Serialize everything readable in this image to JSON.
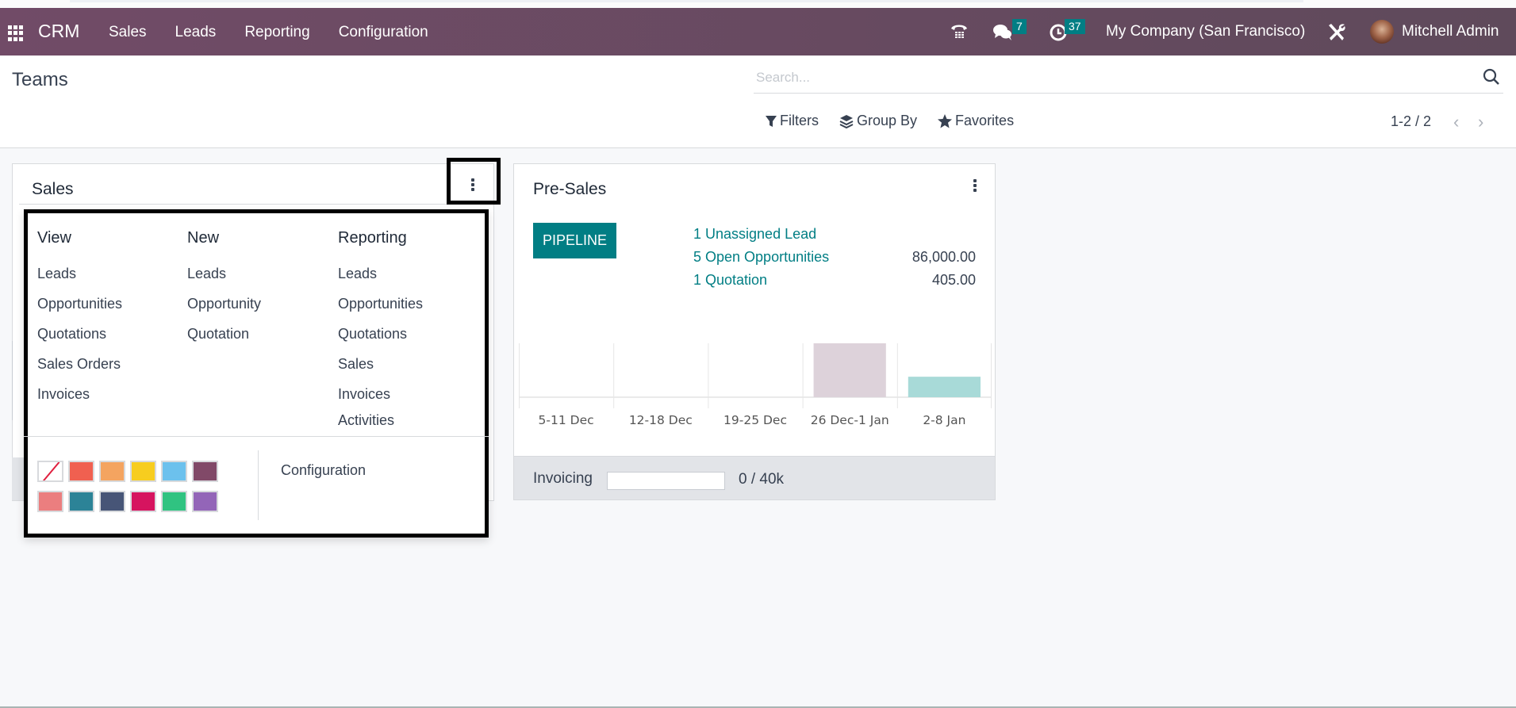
{
  "navbar": {
    "app_name": "CRM",
    "menu": [
      "Sales",
      "Leads",
      "Reporting",
      "Configuration"
    ],
    "messages_count": "7",
    "activities_count": "37",
    "company": "My Company (San Francisco)",
    "user": "Mitchell Admin",
    "icons": [
      "apps-icon",
      "phone-icon",
      "chat-icon",
      "clock-icon",
      "tools-icon"
    ]
  },
  "control_panel": {
    "title": "Teams",
    "search_placeholder": "Search...",
    "filters_label": "Filters",
    "group_by_label": "Group By",
    "favorites_label": "Favorites",
    "pager": "1-2 / 2"
  },
  "cards": {
    "sales": {
      "title": "Sales",
      "dropdown": {
        "view": {
          "heading": "View",
          "items": [
            "Leads",
            "Opportunities",
            "Quotations",
            "Sales Orders",
            "Invoices"
          ]
        },
        "new": {
          "heading": "New",
          "items": [
            "Leads",
            "Opportunity",
            "Quotation"
          ]
        },
        "reporting": {
          "heading": "Reporting",
          "items": [
            "Leads",
            "Opportunities",
            "Quotations",
            "Sales",
            "Invoices",
            "Activities"
          ]
        },
        "colors": [
          "none",
          "#f06050",
          "#f4a460",
          "#f7cd1f",
          "#6cc1ed",
          "#814968",
          "#eb7e7f",
          "#2c8397",
          "#475577",
          "#d6145f",
          "#30c381",
          "#9365b8"
        ],
        "configuration_label": "Configuration"
      }
    },
    "presales": {
      "title": "Pre-Sales",
      "pipeline_label": "PIPELINE",
      "stats": [
        {
          "label": "1 Unassigned Lead",
          "value": ""
        },
        {
          "label": "5 Open Opportunities",
          "value": "86,000.00"
        },
        {
          "label": "1 Quotation",
          "value": "405.00"
        }
      ],
      "invoicing_label": "Invoicing",
      "invoicing_progress": 0,
      "invoicing_text": "0 / 40k"
    }
  },
  "chart_data": {
    "type": "bar",
    "categories": [
      "5-11 Dec",
      "12-18 Dec",
      "19-25 Dec",
      "26 Dec-1 Jan",
      "2-8 Jan"
    ],
    "values": [
      0,
      0,
      0,
      100,
      38
    ],
    "bar_colors": [
      "#ddd2da",
      "#ddd2da",
      "#ddd2da",
      "#ddd2da",
      "#a8dad8"
    ],
    "title": "",
    "xlabel": "",
    "ylabel": "",
    "ylim": [
      0,
      100
    ],
    "grid": true
  }
}
